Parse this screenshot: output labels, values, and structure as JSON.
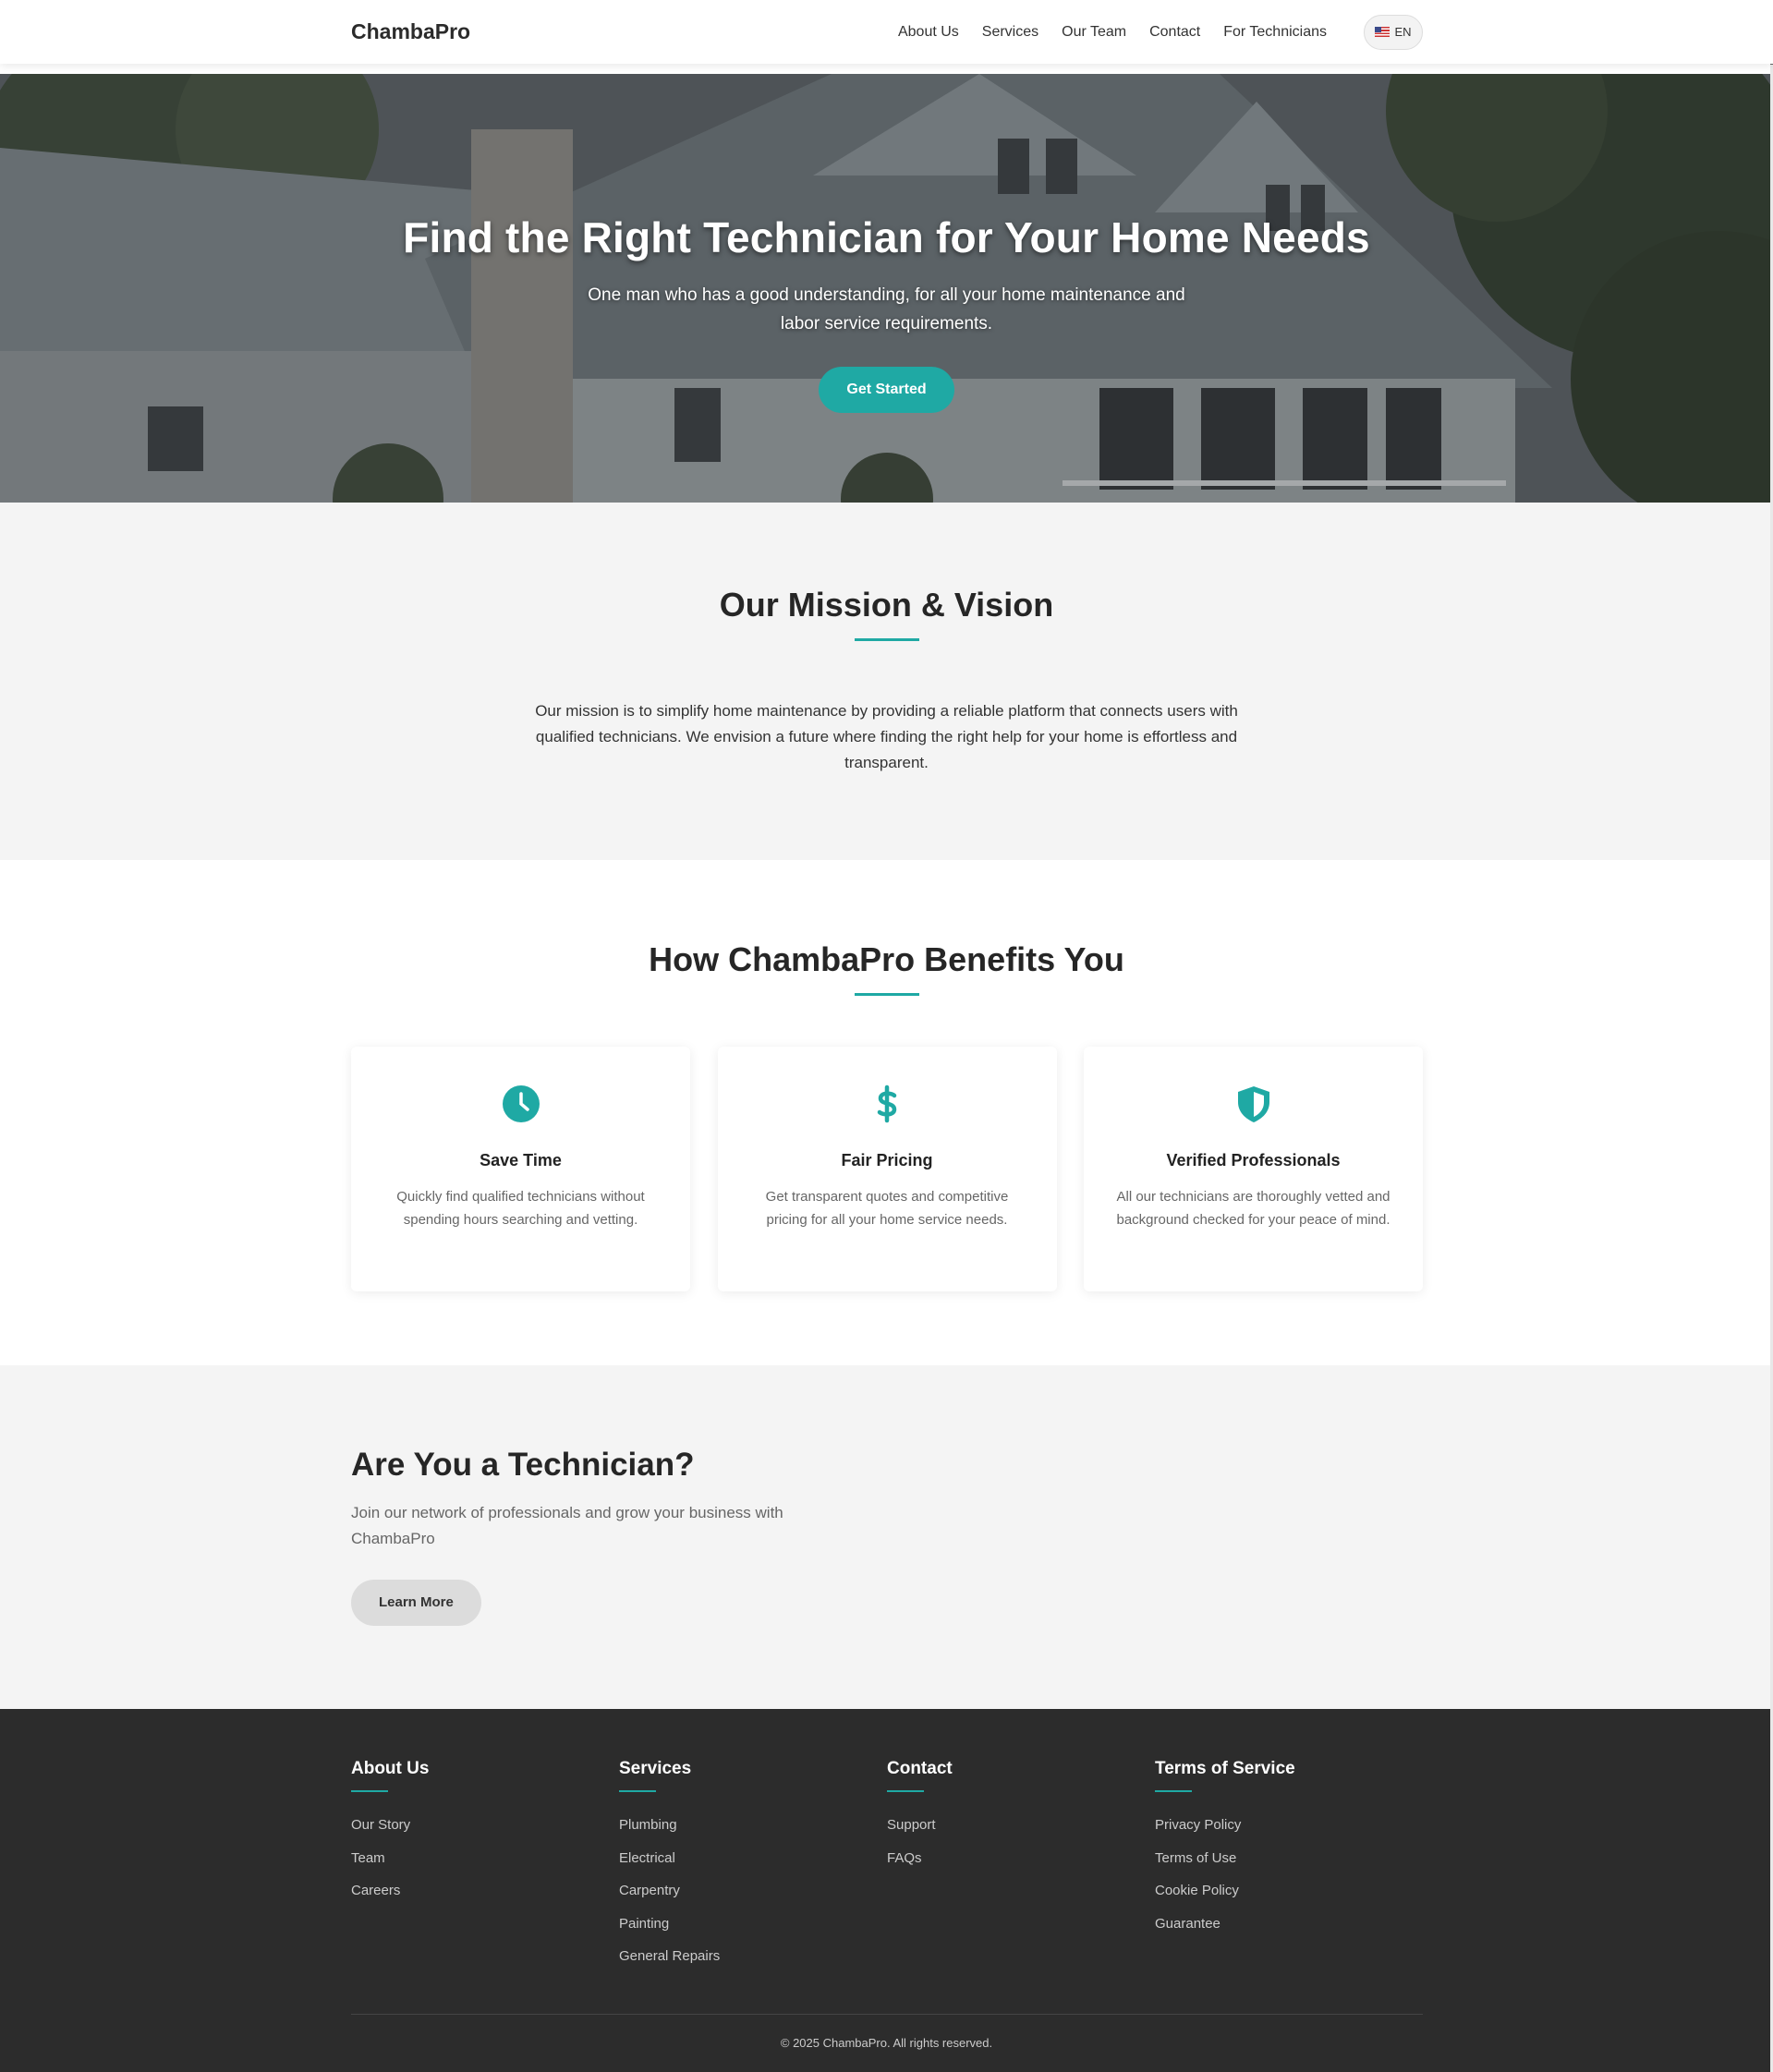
{
  "nav": {
    "logo": "ChambaPro",
    "links": [
      "About Us",
      "Services",
      "Our Team",
      "Contact",
      "For Technicians"
    ],
    "lang": "EN"
  },
  "hero": {
    "title": "Find the Right Technician for Your Home Needs",
    "subtitle": "One man who has a good understanding, for all your home maintenance and labor service requirements.",
    "cta": "Get Started"
  },
  "mission": {
    "title": "Our Mission & Vision",
    "text": "Our mission is to simplify home maintenance by providing a reliable platform that connects users with qualified technicians. We envision a future where finding the right help for your home is effortless and transparent."
  },
  "benefits": {
    "title": "How ChambaPro Benefits You",
    "cards": [
      {
        "icon": "clock-icon",
        "title": "Save Time",
        "text": "Quickly find qualified technicians without spending hours searching and vetting."
      },
      {
        "icon": "dollar-icon",
        "title": "Fair Pricing",
        "text": "Get transparent quotes and competitive pricing for all your home service needs."
      },
      {
        "icon": "shield-icon",
        "title": "Verified Professionals",
        "text": "All our technicians are thoroughly vetted and background checked for your peace of mind."
      }
    ]
  },
  "technician": {
    "title": "Are You a Technician?",
    "subtitle": "Join our network of professionals and grow your business with ChambaPro",
    "cta": "Learn More"
  },
  "footer": {
    "columns": [
      {
        "title": "About Us",
        "links": [
          "Our Story",
          "Team",
          "Careers"
        ]
      },
      {
        "title": "Services",
        "links": [
          "Plumbing",
          "Electrical",
          "Carpentry",
          "Painting",
          "General Repairs"
        ]
      },
      {
        "title": "Contact",
        "links": [
          "Support",
          "FAQs"
        ]
      },
      {
        "title": "Terms of Service",
        "links": [
          "Privacy Policy",
          "Terms of Use",
          "Cookie Policy",
          "Guarantee"
        ]
      }
    ],
    "copyright": "© 2025 ChambaPro. All rights reserved."
  },
  "colors": {
    "accent": "#1fa9a4",
    "footer_bg": "#2c2c2c",
    "section_bg": "#f4f4f4"
  }
}
